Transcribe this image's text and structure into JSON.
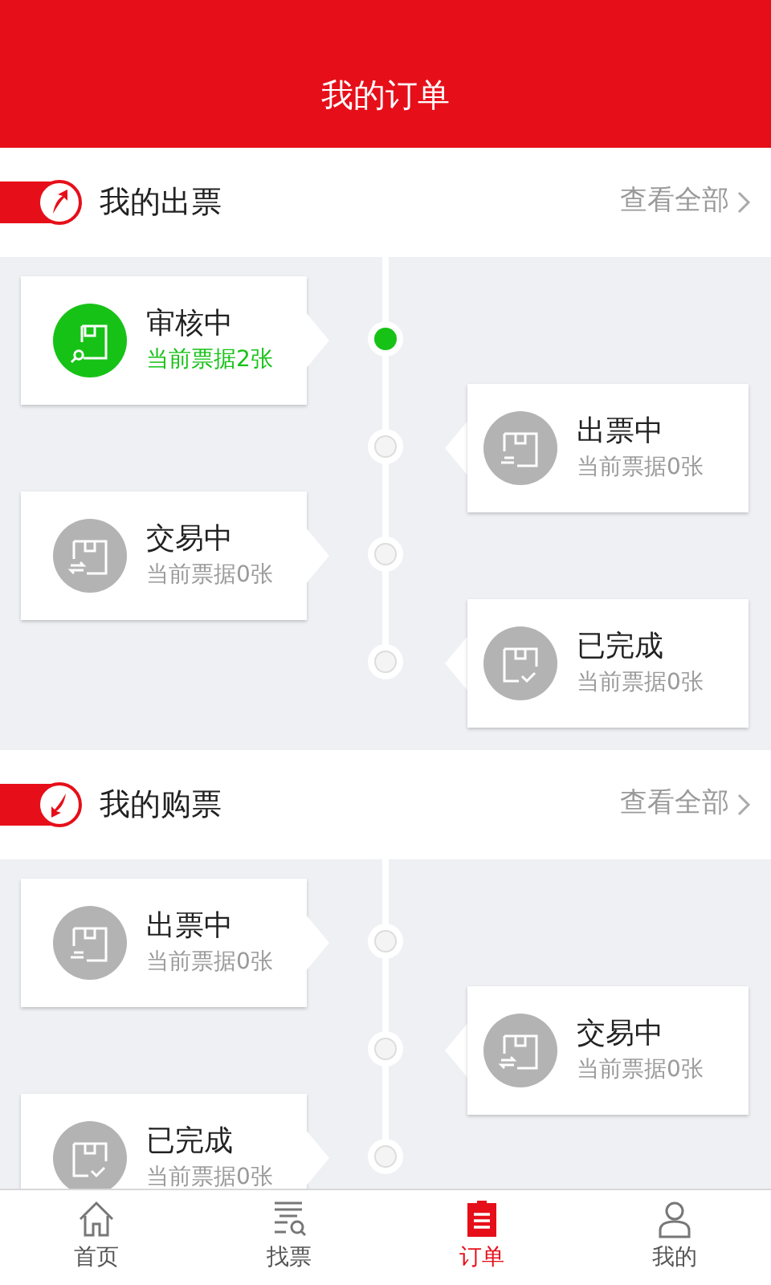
{
  "header": {
    "title": "我的订单"
  },
  "sections": [
    {
      "title": "我的出票",
      "kind": "up",
      "more": "查看全部",
      "steps": [
        {
          "title": "审核中",
          "subtitle": "当前票据2张",
          "active": true,
          "kind": "search"
        },
        {
          "title": "出票中",
          "subtitle": "当前票据0张",
          "active": false,
          "kind": "lines"
        },
        {
          "title": "交易中",
          "subtitle": "当前票据0张",
          "active": false,
          "kind": "exchange"
        },
        {
          "title": "已完成",
          "subtitle": "当前票据0张",
          "active": false,
          "kind": "check"
        }
      ]
    },
    {
      "title": "我的购票",
      "kind": "down",
      "more": "查看全部",
      "steps": [
        {
          "title": "出票中",
          "subtitle": "当前票据0张",
          "active": false,
          "kind": "lines"
        },
        {
          "title": "交易中",
          "subtitle": "当前票据0张",
          "active": false,
          "kind": "exchange"
        },
        {
          "title": "已完成",
          "subtitle": "当前票据0张",
          "active": false,
          "kind": "check"
        }
      ]
    }
  ],
  "tab_bar": [
    {
      "label": "首页",
      "kind": "home",
      "selected": false
    },
    {
      "label": "找票",
      "kind": "find",
      "selected": false
    },
    {
      "label": "订单",
      "kind": "order",
      "selected": true
    },
    {
      "label": "我的",
      "kind": "user",
      "selected": false
    }
  ]
}
